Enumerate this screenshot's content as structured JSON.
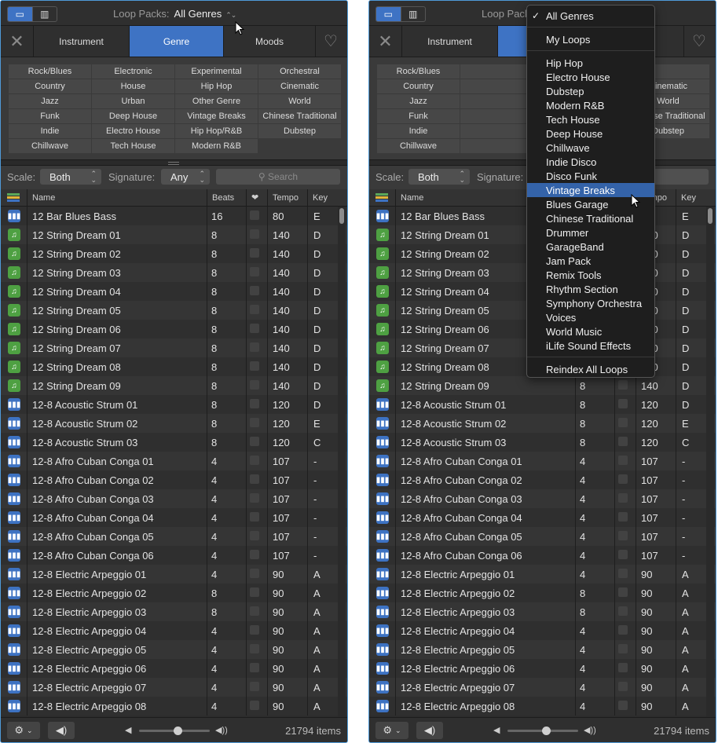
{
  "toolbar": {
    "view_list_icon": "list-view-icon",
    "view_column_icon": "column-view-icon",
    "loop_packs_label": "Loop Packs:",
    "loop_packs_value": "All Genres"
  },
  "tabs": {
    "instrument": "Instrument",
    "genre": "Genre",
    "moods": "Moods",
    "selected": "Genre"
  },
  "genres": [
    "Rock/Blues",
    "Electronic",
    "Experimental",
    "Orchestral",
    "Country",
    "House",
    "Hip Hop",
    "Cinematic",
    "Jazz",
    "Urban",
    "Other Genre",
    "World",
    "Funk",
    "Deep House",
    "Vintage Breaks",
    "Chinese Traditional",
    "Indie",
    "Electro House",
    "Hip Hop/R&B",
    "Dubstep",
    "Chillwave",
    "Tech House",
    "Modern R&B"
  ],
  "filters": {
    "scale_label": "Scale:",
    "scale_value": "Both",
    "signature_label": "Signature:",
    "signature_value": "Any",
    "search_placeholder": "Search"
  },
  "columns": {
    "name": "Name",
    "beats": "Beats",
    "tempo": "Tempo",
    "key": "Key"
  },
  "rows": [
    {
      "type": "audio",
      "name": "12 Bar Blues Bass",
      "beats": "16",
      "tempo": "80",
      "key": "E"
    },
    {
      "type": "midi",
      "name": "12 String Dream 01",
      "beats": "8",
      "tempo": "140",
      "key": "D"
    },
    {
      "type": "midi",
      "name": "12 String Dream 02",
      "beats": "8",
      "tempo": "140",
      "key": "D"
    },
    {
      "type": "midi",
      "name": "12 String Dream 03",
      "beats": "8",
      "tempo": "140",
      "key": "D"
    },
    {
      "type": "midi",
      "name": "12 String Dream 04",
      "beats": "8",
      "tempo": "140",
      "key": "D"
    },
    {
      "type": "midi",
      "name": "12 String Dream 05",
      "beats": "8",
      "tempo": "140",
      "key": "D"
    },
    {
      "type": "midi",
      "name": "12 String Dream 06",
      "beats": "8",
      "tempo": "140",
      "key": "D"
    },
    {
      "type": "midi",
      "name": "12 String Dream 07",
      "beats": "8",
      "tempo": "140",
      "key": "D"
    },
    {
      "type": "midi",
      "name": "12 String Dream 08",
      "beats": "8",
      "tempo": "140",
      "key": "D"
    },
    {
      "type": "midi",
      "name": "12 String Dream 09",
      "beats": "8",
      "tempo": "140",
      "key": "D"
    },
    {
      "type": "audio",
      "name": "12-8 Acoustic Strum 01",
      "beats": "8",
      "tempo": "120",
      "key": "D"
    },
    {
      "type": "audio",
      "name": "12-8 Acoustic Strum 02",
      "beats": "8",
      "tempo": "120",
      "key": "E"
    },
    {
      "type": "audio",
      "name": "12-8 Acoustic Strum 03",
      "beats": "8",
      "tempo": "120",
      "key": "C"
    },
    {
      "type": "audio",
      "name": "12-8 Afro Cuban Conga 01",
      "beats": "4",
      "tempo": "107",
      "key": "-"
    },
    {
      "type": "audio",
      "name": "12-8 Afro Cuban Conga 02",
      "beats": "4",
      "tempo": "107",
      "key": "-"
    },
    {
      "type": "audio",
      "name": "12-8 Afro Cuban Conga 03",
      "beats": "4",
      "tempo": "107",
      "key": "-"
    },
    {
      "type": "audio",
      "name": "12-8 Afro Cuban Conga 04",
      "beats": "4",
      "tempo": "107",
      "key": "-"
    },
    {
      "type": "audio",
      "name": "12-8 Afro Cuban Conga 05",
      "beats": "4",
      "tempo": "107",
      "key": "-"
    },
    {
      "type": "audio",
      "name": "12-8 Afro Cuban Conga 06",
      "beats": "4",
      "tempo": "107",
      "key": "-"
    },
    {
      "type": "audio",
      "name": "12-8 Electric Arpeggio 01",
      "beats": "4",
      "tempo": "90",
      "key": "A"
    },
    {
      "type": "audio",
      "name": "12-8 Electric Arpeggio 02",
      "beats": "8",
      "tempo": "90",
      "key": "A"
    },
    {
      "type": "audio",
      "name": "12-8 Electric Arpeggio 03",
      "beats": "8",
      "tempo": "90",
      "key": "A"
    },
    {
      "type": "audio",
      "name": "12-8 Electric Arpeggio 04",
      "beats": "4",
      "tempo": "90",
      "key": "A"
    },
    {
      "type": "audio",
      "name": "12-8 Electric Arpeggio 05",
      "beats": "4",
      "tempo": "90",
      "key": "A"
    },
    {
      "type": "audio",
      "name": "12-8 Electric Arpeggio 06",
      "beats": "4",
      "tempo": "90",
      "key": "A"
    },
    {
      "type": "audio",
      "name": "12-8 Electric Arpeggio 07",
      "beats": "4",
      "tempo": "90",
      "key": "A"
    },
    {
      "type": "audio",
      "name": "12-8 Electric Arpeggio 08",
      "beats": "4",
      "tempo": "90",
      "key": "A"
    }
  ],
  "bottom": {
    "gear_icon": "gear-icon",
    "speaker_icon": "speaker-icon",
    "volume": 0.55,
    "item_count": "21794 items"
  },
  "dropdown": {
    "checked": "All Genres",
    "highlighted": "Vintage Breaks",
    "top_items": [
      "All Genres"
    ],
    "mid_items": [
      "My Loops"
    ],
    "genre_items": [
      "Hip Hop",
      "Electro House",
      "Dubstep",
      "Modern R&B",
      "Tech House",
      "Deep House",
      "Chillwave",
      "Indie Disco",
      "Disco Funk",
      "Vintage Breaks",
      "Blues Garage",
      "Chinese Traditional",
      "Drummer",
      "GarageBand",
      "Jam Pack",
      "Remix Tools",
      "Rhythm Section",
      "Symphony Orchestra",
      "Voices",
      "World Music",
      "iLife Sound Effects"
    ],
    "bottom_items": [
      "Reindex All Loops"
    ]
  },
  "colors": {
    "accent": "#3e73c4",
    "audio_icon": "#3d72c2",
    "midi_icon": "#4ea042",
    "highlight": "#3463a9"
  }
}
